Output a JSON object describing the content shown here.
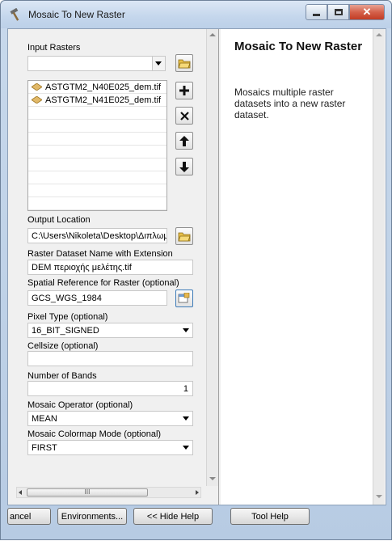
{
  "window": {
    "title": "Mosaic To New Raster"
  },
  "form": {
    "input_rasters_label": "Input Rasters",
    "input_rasters_value": "",
    "input_rasters_list": [
      "ASTGTM2_N40E025_dem.tif",
      "ASTGTM2_N41E025_dem.tif"
    ],
    "output_location_label": "Output Location",
    "output_location_value": "C:\\Users\\Nikoleta\\Desktop\\Διπλωμ",
    "dataset_name_label": "Raster Dataset Name with Extension",
    "dataset_name_value": "DEM περιοχής μελέτης.tif",
    "spatial_ref_label": "Spatial Reference for Raster (optional)",
    "spatial_ref_value": "GCS_WGS_1984",
    "pixel_type_label": "Pixel Type (optional)",
    "pixel_type_value": "16_BIT_SIGNED",
    "cellsize_label": "Cellsize (optional)",
    "cellsize_value": "",
    "num_bands_label": "Number of Bands",
    "num_bands_value": "1",
    "mosaic_operator_label": "Mosaic Operator (optional)",
    "mosaic_operator_value": "MEAN",
    "colormap_mode_label": "Mosaic Colormap Mode (optional)",
    "colormap_mode_value": "FIRST"
  },
  "hscroll_grip": "III",
  "help": {
    "title": "Mosaic To New Raster",
    "body": "Mosaics multiple raster datasets into a new raster dataset."
  },
  "buttons": {
    "cancel": "ancel",
    "environments": "Environments...",
    "hide_help": "<< Hide Help",
    "tool_help": "Tool Help"
  },
  "colors": {
    "title_gradient": "#c4d6ec",
    "close_button": "#c23d25",
    "panel_bg": "#f0f0f0"
  },
  "icons": [
    "hammer-icon",
    "open-folder-icon",
    "plus-icon",
    "remove-icon",
    "up-arrow-icon",
    "down-arrow-icon",
    "raster-dataset-icon",
    "spatial-reference-icon"
  ]
}
